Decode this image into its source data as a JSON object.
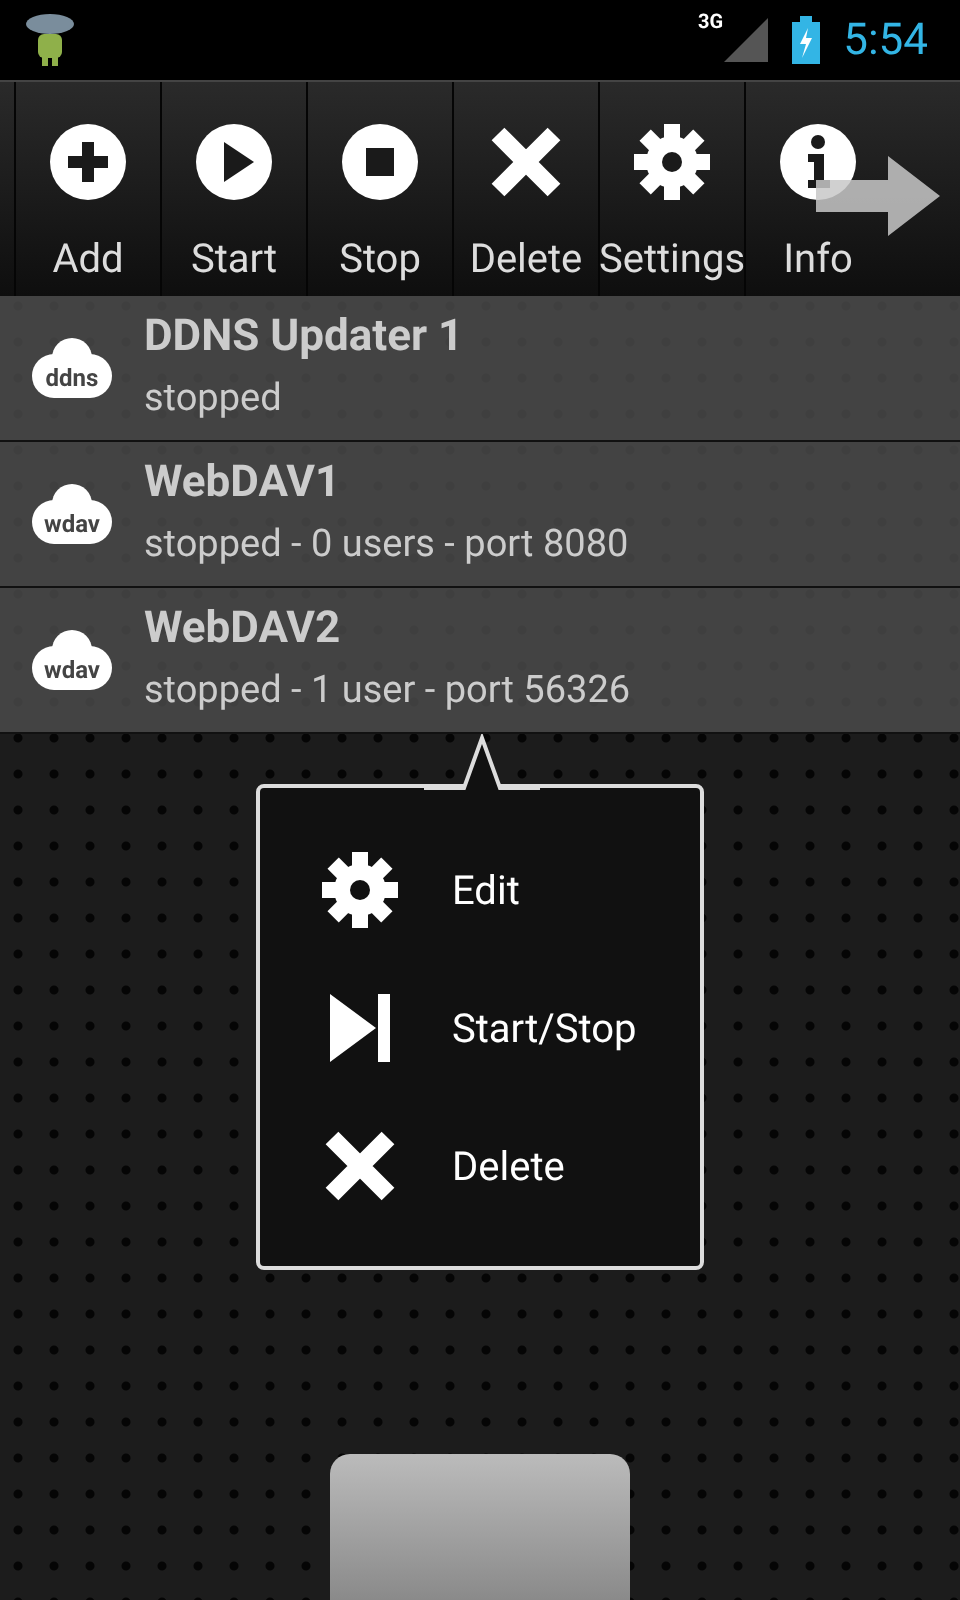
{
  "status_bar": {
    "network": "3G",
    "time": "5:54"
  },
  "toolbar": [
    {
      "label": "Add",
      "kind": "add"
    },
    {
      "label": "Start",
      "kind": "play"
    },
    {
      "label": "Stop",
      "kind": "stop"
    },
    {
      "label": "Delete",
      "kind": "delete"
    },
    {
      "label": "Settings",
      "kind": "gear"
    },
    {
      "label": "Info",
      "kind": "info"
    }
  ],
  "services": [
    {
      "badge": "ddns",
      "name": "DDNS Updater 1",
      "status": "stopped"
    },
    {
      "badge": "wdav",
      "name": "WebDAV1",
      "status": "stopped - 0 users - port 8080"
    },
    {
      "badge": "wdav",
      "name": "WebDAV2",
      "status": "stopped - 1 user - port 56326"
    }
  ],
  "context_menu": [
    {
      "label": "Edit",
      "kind": "gear"
    },
    {
      "label": "Start/Stop",
      "kind": "startstop"
    },
    {
      "label": "Delete",
      "kind": "delete"
    }
  ]
}
